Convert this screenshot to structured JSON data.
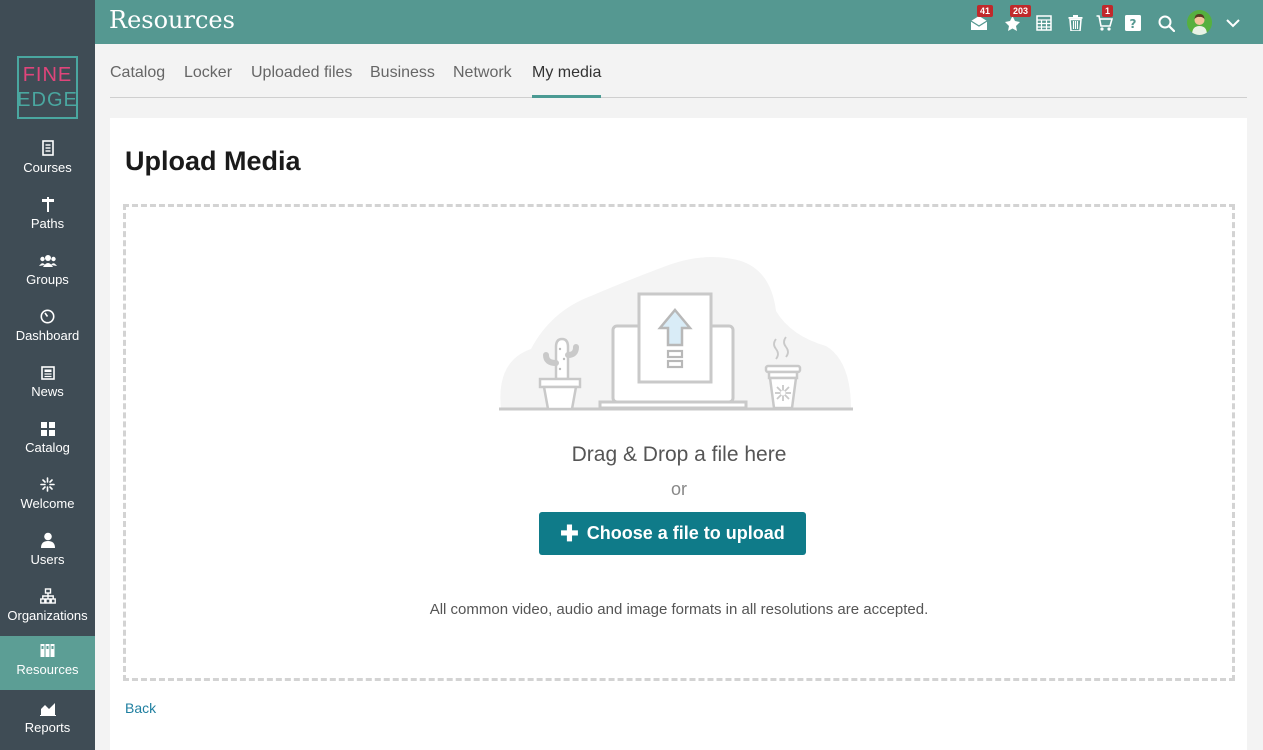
{
  "header": {
    "title": "Resources",
    "icons": [
      {
        "name": "messages-icon",
        "badge": "41"
      },
      {
        "name": "notifications-icon",
        "badge": "203"
      },
      {
        "name": "calendar-icon",
        "badge": ""
      },
      {
        "name": "trash-icon",
        "badge": ""
      },
      {
        "name": "cart-icon",
        "badge": "1"
      },
      {
        "name": "help-icon",
        "badge": ""
      },
      {
        "name": "search-icon",
        "badge": ""
      },
      {
        "name": "avatar",
        "badge": ""
      },
      {
        "name": "chevron-down-icon",
        "badge": ""
      }
    ]
  },
  "logo": {
    "line1": "FINE",
    "line2": "EDGE"
  },
  "sidebar": {
    "items": [
      {
        "label": "Courses",
        "icon": "courses-icon"
      },
      {
        "label": "Paths",
        "icon": "signpost-icon"
      },
      {
        "label": "Groups",
        "icon": "groups-icon"
      },
      {
        "label": "Dashboard",
        "icon": "dashboard-icon"
      },
      {
        "label": "News",
        "icon": "news-icon"
      },
      {
        "label": "Catalog",
        "icon": "grid-icon"
      },
      {
        "label": "Welcome",
        "icon": "sparkle-icon"
      },
      {
        "label": "Users",
        "icon": "user-icon"
      },
      {
        "label": "Organizations",
        "icon": "org-chart-icon"
      },
      {
        "label": "Resources",
        "icon": "books-icon",
        "active": true
      },
      {
        "label": "Reports",
        "icon": "chart-icon"
      }
    ]
  },
  "tabs": [
    {
      "label": "Catalog"
    },
    {
      "label": "Locker"
    },
    {
      "label": "Uploaded files"
    },
    {
      "label": "Business"
    },
    {
      "label": "Network"
    },
    {
      "label": "My media",
      "active": true
    }
  ],
  "main": {
    "heading": "Upload Media",
    "drop_title": "Drag & Drop a file here",
    "or_text": "or",
    "upload_button": "Choose a file to upload",
    "note": "All common video, audio and image formats in all resolutions are accepted.",
    "back_link": "Back"
  },
  "colors": {
    "header": "#559891",
    "sidebar": "#3f4c55",
    "sidebar_active": "#5c9e95",
    "button": "#0f7b89",
    "badge": "#c0292b"
  }
}
